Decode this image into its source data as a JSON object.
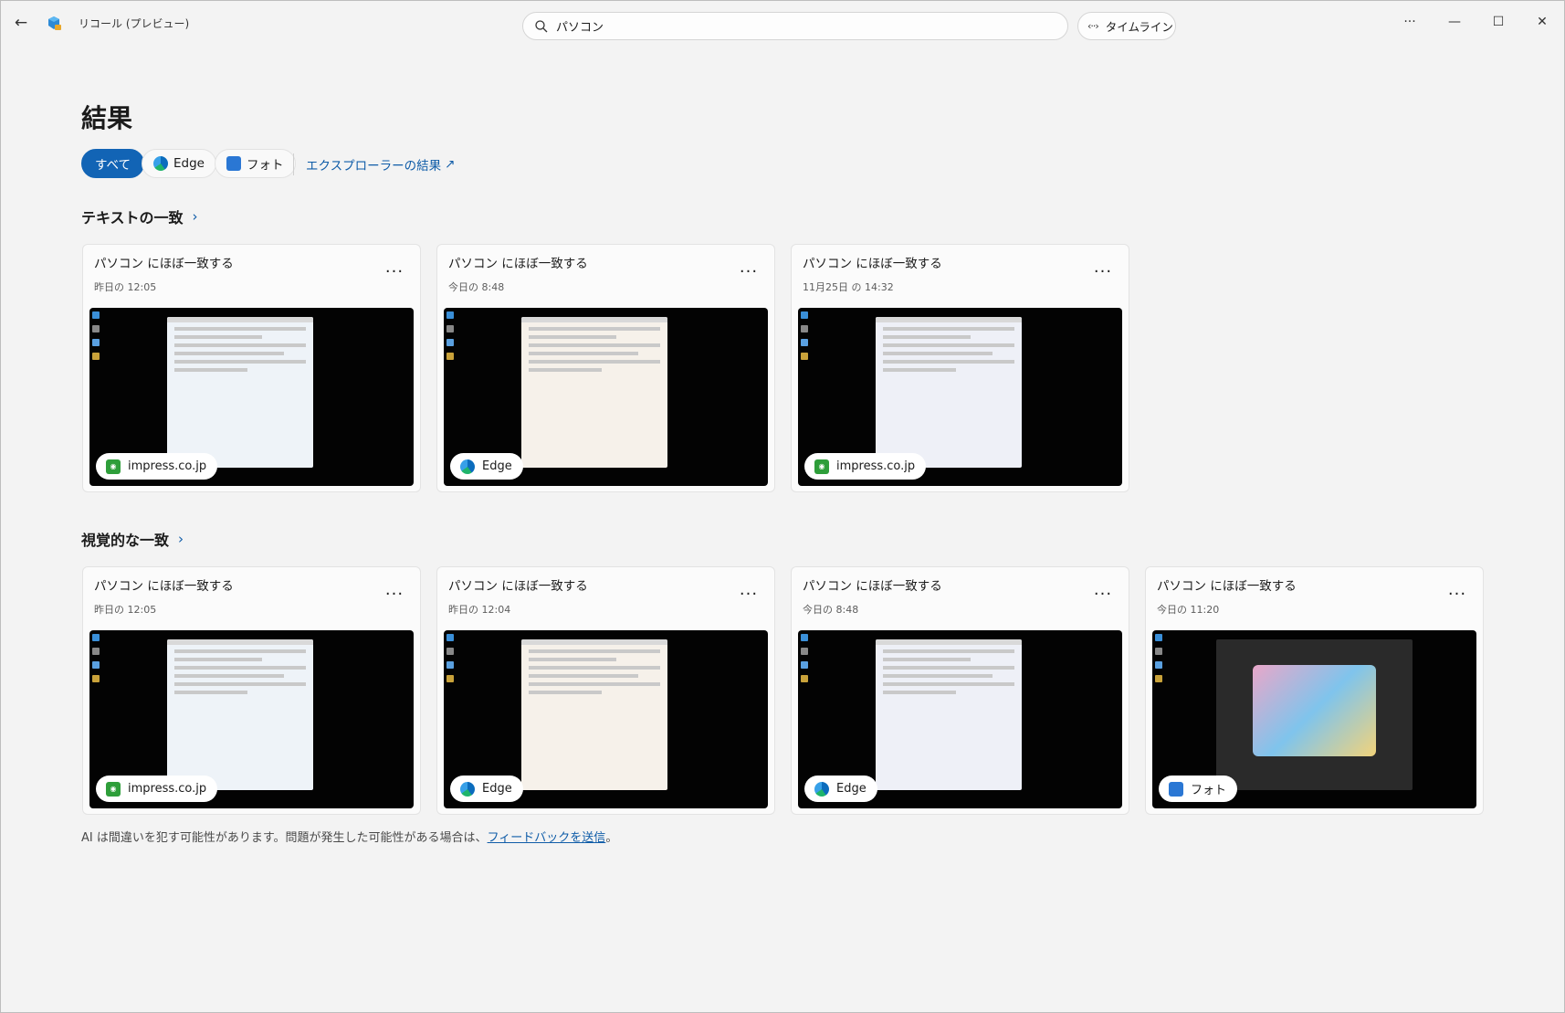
{
  "app": {
    "title": "リコール (プレビュー)",
    "search_value": "パソコン",
    "timeline_label": "タイムライン"
  },
  "page": {
    "title": "結果",
    "filters": [
      "すべて",
      "Edge",
      "フォト"
    ],
    "explorer_link": "エクスプローラーの結果"
  },
  "text_matches": {
    "title": "テキストの一致",
    "cards": [
      {
        "title": "パソコン にほぼ一致する",
        "time": "昨日の 12:05",
        "source": "impress.co.jp",
        "source_icon": "impress-icon"
      },
      {
        "title": "パソコン にほぼ一致する",
        "time": "今日の 8:48",
        "source": "Edge",
        "source_icon": "edge-icon"
      },
      {
        "title": "パソコン にほぼ一致する",
        "time": "11月25日 の 14:32",
        "source": "impress.co.jp",
        "source_icon": "impress-icon"
      }
    ]
  },
  "visual_matches": {
    "title": "視覚的な一致",
    "cards": [
      {
        "title": "パソコン にほぼ一致する",
        "time": "昨日の 12:05",
        "source": "impress.co.jp",
        "source_icon": "impress-icon"
      },
      {
        "title": "パソコン にほぼ一致する",
        "time": "昨日の 12:04",
        "source": "Edge",
        "source_icon": "edge-icon"
      },
      {
        "title": "パソコン にほぼ一致する",
        "time": "今日の 8:48",
        "source": "Edge",
        "source_icon": "edge-icon"
      },
      {
        "title": "パソコン にほぼ一致する",
        "time": "今日の 11:20",
        "source": "フォト",
        "source_icon": "photos-icon"
      }
    ]
  },
  "footer": {
    "text": "AI は間違いを犯す可能性があります。問題が発生した可能性がある場合は、",
    "link": "フィードバックを送信",
    "end": "。"
  },
  "colors": {
    "accent": "#1264b5",
    "link": "#0f5ca8",
    "background": "#f3f3f3"
  }
}
